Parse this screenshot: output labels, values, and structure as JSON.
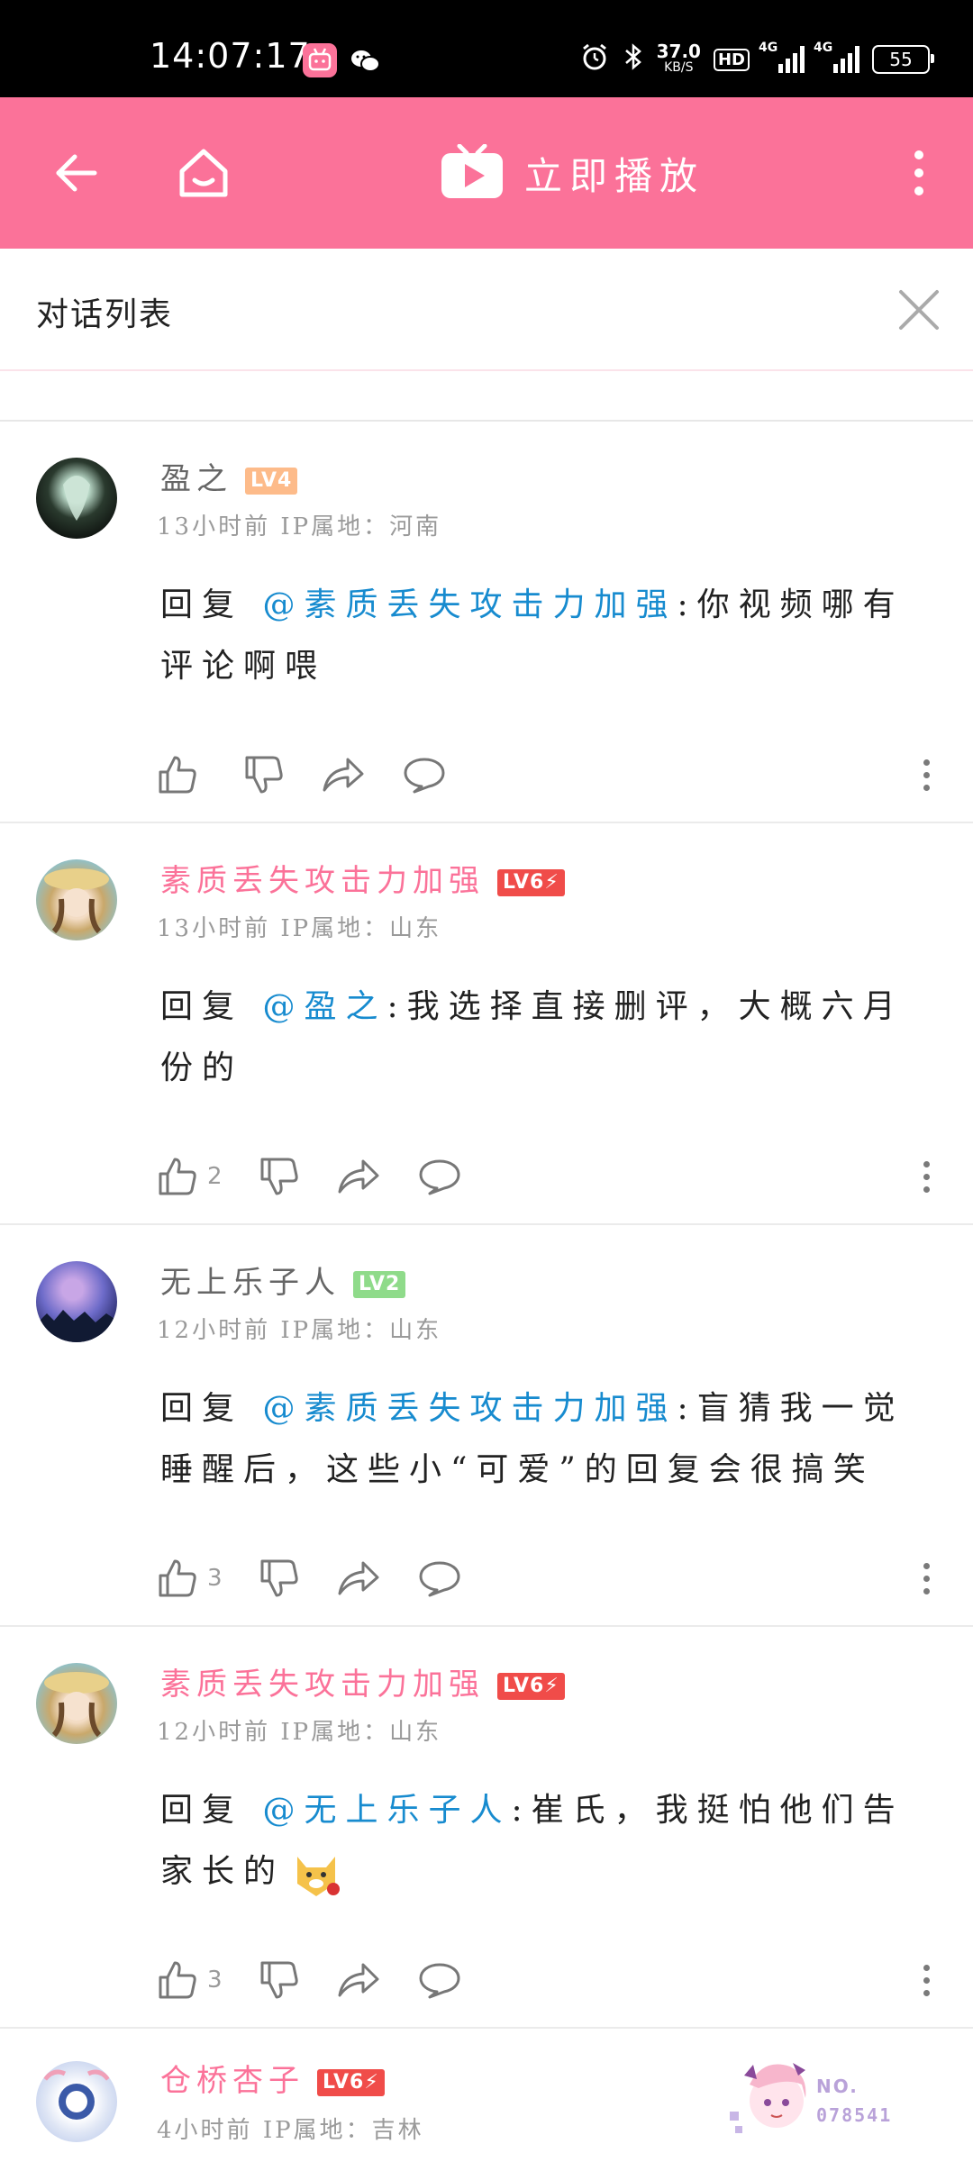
{
  "status_bar": {
    "time": "14:07:17",
    "speed_value": "37.0",
    "speed_unit": "KB/S",
    "hd_label": "HD",
    "net1": "4G",
    "net2": "4G",
    "battery": "55",
    "icons": [
      "bilibili-app-icon",
      "wechat-icon",
      "alarm-icon",
      "bluetooth-icon"
    ]
  },
  "app_bar": {
    "back_icon": "arrow-left-icon",
    "home_icon": "home-icon",
    "play_icon": "tv-play-icon",
    "play_label": "立即播放",
    "more_icon": "more-vertical-icon",
    "bg_color": "#fb7299"
  },
  "sheet": {
    "title": "对话列表",
    "close_icon": "close-icon"
  },
  "colors": {
    "mention": "#178bcf",
    "vip_name": "#fb7299",
    "lv4": "#fdbb8a",
    "lv6": "#f04c49",
    "lv2": "#8fdb8a"
  },
  "comments": [
    {
      "username": "盈之",
      "level": "LV4",
      "time": "13小时前",
      "ip_label": "IP属地：",
      "location": "河南",
      "reply_prefix": "回复",
      "mention": "@素质丢失攻击力加强",
      "content": ":你视频哪有评论啊喂",
      "likes": ""
    },
    {
      "username": "素质丢失攻击力加强",
      "level": "LV6",
      "time": "13小时前",
      "ip_label": "IP属地：",
      "location": "山东",
      "reply_prefix": "回复",
      "mention": "@盈之",
      "content": ":我选择直接删评，大概六月份的",
      "likes": "2"
    },
    {
      "username": "无上乐子人",
      "level": "LV2",
      "time": "12小时前",
      "ip_label": "IP属地：",
      "location": "山东",
      "reply_prefix": "回复",
      "mention": "@素质丢失攻击力加强",
      "content": ":盲猜我一觉睡醒后，这些小“可爱”的回复会很搞笑",
      "likes": "3"
    },
    {
      "username": "素质丢失攻击力加强",
      "level": "LV6",
      "time": "12小时前",
      "ip_label": "IP属地：",
      "location": "山东",
      "reply_prefix": "回复",
      "mention": "@无上乐子人",
      "content": ":崔氏，我挺怕他们告家长的",
      "likes": "3"
    },
    {
      "username": "仓桥杏子",
      "level": "LV6",
      "time": "4小时前",
      "ip_label": "IP属地：",
      "location": "吉林"
    }
  ],
  "fan_badge": {
    "label": "NO.",
    "number": "078541"
  }
}
